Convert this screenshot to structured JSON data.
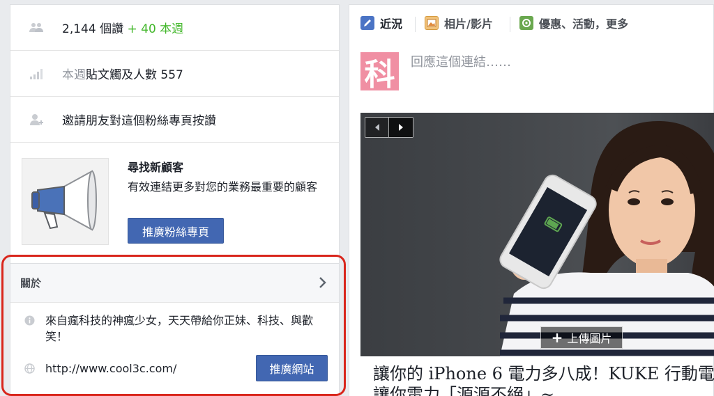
{
  "left": {
    "likes": {
      "count": "2,144 個讚",
      "weekly_delta": "+ 40 本週"
    },
    "reach": {
      "prefix": "本週",
      "text": "貼文觸及人數 557"
    },
    "invite": {
      "text": "邀請朋友對這個粉絲專頁按讚"
    },
    "promo": {
      "title": "尋找新顧客",
      "description": "有效連結更多對您的業務最重要的顧客",
      "button_label": "推廣粉絲專頁"
    },
    "about": {
      "title": "關於",
      "description": "來自瘋科技的神瘋少女，天天帶給你正妹、科技、與歡笑！",
      "website": "http://www.cool3c.com/",
      "website_button": "推廣網站"
    }
  },
  "right": {
    "tabs": [
      {
        "label": "近況",
        "icon": "pencil-icon"
      },
      {
        "label": "相片/影片",
        "icon": "photo-icon"
      },
      {
        "label": "優惠、活動，更多",
        "icon": "offer-icon"
      }
    ],
    "composer": {
      "avatar_text": "科",
      "placeholder": "回應這個連結……"
    },
    "post": {
      "upload_label": "上傳圖片",
      "headline_line1": "讓你的 iPhone 6 電力多八成！KUKE 行動電",
      "headline_line2": "讓你電力「源源不絕」~"
    }
  },
  "colors": {
    "accent_blue": "#4267b2",
    "positive_green": "#42b72a",
    "highlight_red": "#d9261c",
    "avatar_pink": "#f08fa3"
  }
}
